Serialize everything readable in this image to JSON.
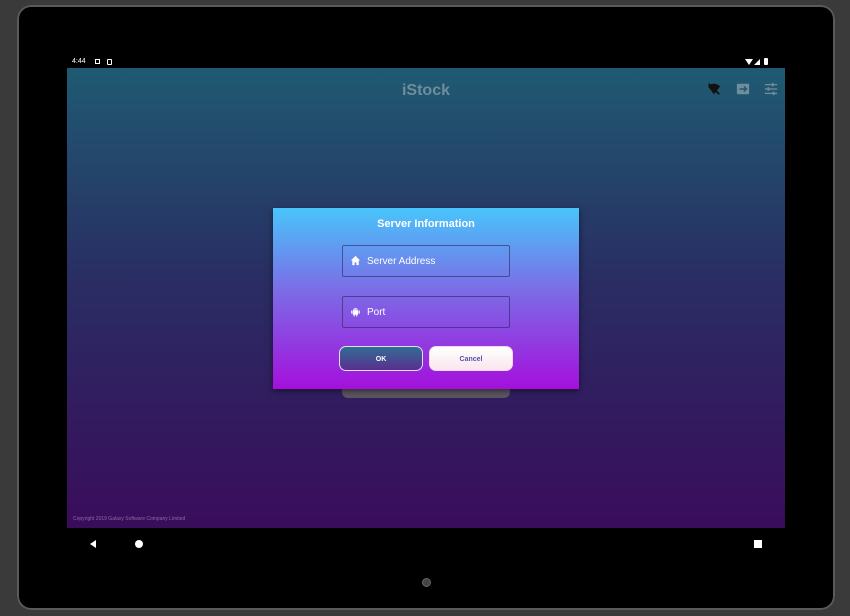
{
  "status_bar": {
    "time": "4:44"
  },
  "app": {
    "title": "iStock",
    "toolbar_icons": [
      "wifi-off-icon",
      "import-icon",
      "settings-sliders-icon"
    ],
    "footer": "Copyright 2019 Galaxy Software Company Limited"
  },
  "dialog": {
    "title": "Server Information",
    "server_address": {
      "placeholder": "Server Address",
      "value": "",
      "icon": "home-icon"
    },
    "port": {
      "placeholder": "Port",
      "value": "",
      "icon": "android-icon"
    },
    "ok_label": "OK",
    "cancel_label": "Cancel"
  },
  "nav_bar": {
    "buttons": [
      "back-icon",
      "home-icon",
      "recents-icon"
    ]
  },
  "colors": {
    "app_gradient": [
      "#1f5a72",
      "#292e63",
      "#3a0c5c"
    ],
    "dialog_gradient": [
      "#48c5fb",
      "#7b6de6",
      "#a410dc"
    ]
  }
}
